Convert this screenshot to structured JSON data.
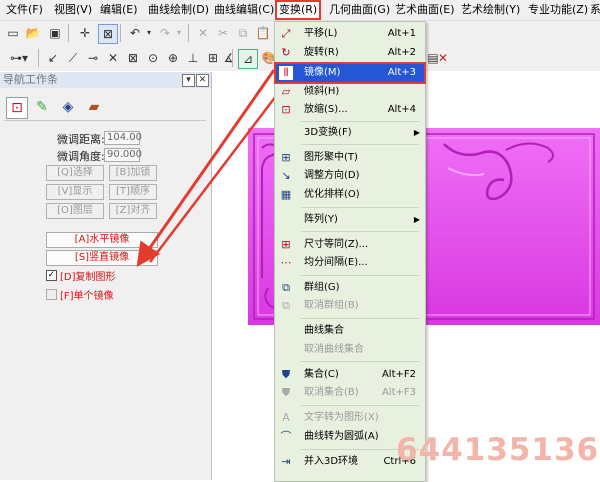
{
  "menubar": {
    "items": [
      {
        "label": "文件(F)"
      },
      {
        "label": "视图(V)"
      },
      {
        "label": "编辑(E)"
      },
      {
        "label": "曲线绘制(D)"
      },
      {
        "label": "曲线编辑(C)"
      },
      {
        "label": "变换(R)"
      },
      {
        "label": "几何曲面(G)"
      },
      {
        "label": "艺术曲面(E)"
      },
      {
        "label": "艺术绘制(Y)"
      },
      {
        "label": "专业功能(Z)"
      },
      {
        "label": "系"
      }
    ]
  },
  "navpanel": {
    "title": "导航工作条",
    "fine_distance_label": "微调距离:",
    "fine_distance_value": "104.00",
    "fine_angle_label": "微调角度:",
    "fine_angle_value": "90.000",
    "buttons": [
      "[Q]选择",
      "[B]加锁",
      "[V]显示",
      "[T]顺序",
      "[O]图层",
      "[Z]对齐"
    ],
    "mirror_h": "[A]水平镜像",
    "mirror_v": "[S]竖直镜像",
    "copy_shape": "[D]复制图形",
    "copy_checked": true,
    "single_mirror": "[F]单个镜像",
    "single_checked": false
  },
  "dropdown": {
    "items": [
      {
        "label": "平移(L)",
        "shortcut": "Alt+1",
        "icon": "translate-icon"
      },
      {
        "label": "旋转(R)",
        "shortcut": "Alt+2",
        "icon": "rotate-icon"
      },
      {
        "label": "镜像(M)",
        "shortcut": "Alt+3",
        "icon": "mirror-icon",
        "highlight": true
      },
      {
        "label": "倾斜(H)",
        "shortcut": "",
        "icon": "skew-icon"
      },
      {
        "label": "放缩(S)...",
        "shortcut": "Alt+4",
        "icon": "scale-icon"
      },
      {
        "label": "3D变换(F)",
        "submenu": true
      },
      {
        "label": "图形聚中(T)",
        "icon": "center-icon"
      },
      {
        "label": "调整方向(D)",
        "icon": "direction-icon"
      },
      {
        "label": "优化排样(O)",
        "icon": "nesting-icon"
      },
      {
        "label": "阵列(Y)",
        "submenu": true
      },
      {
        "label": "尺寸等同(Z)...",
        "icon": "equal-size-icon"
      },
      {
        "label": "均分间隔(E)...",
        "icon": "equal-spacing-icon"
      },
      {
        "label": "群组(G)",
        "icon": "group-icon"
      },
      {
        "label": "取消群组(B)",
        "icon": "ungroup-icon",
        "disabled": true
      },
      {
        "label": "曲线集合"
      },
      {
        "label": "取消曲线集合",
        "disabled": true
      },
      {
        "label": "集合(C)",
        "shortcut": "Alt+F2",
        "icon": "set-icon"
      },
      {
        "label": "取消集合(B)",
        "shortcut": "Alt+F3",
        "icon": "unset-icon",
        "disabled": true
      },
      {
        "label": "文字转为图形(X)",
        "icon": "text-to-shape-icon",
        "disabled": true
      },
      {
        "label": "曲线转为圆弧(A)",
        "icon": "curve-to-arc-icon"
      },
      {
        "label": "并入3D环境",
        "shortcut": "Ctrl+6",
        "icon": "merge-3d-icon"
      }
    ]
  },
  "watermark": "644135136",
  "colors": {
    "highlight": "#2456d6",
    "annotation_red": "#e53b2f",
    "relief_magenta": "#e040e8",
    "menu_bg": "#e8f0e0"
  }
}
